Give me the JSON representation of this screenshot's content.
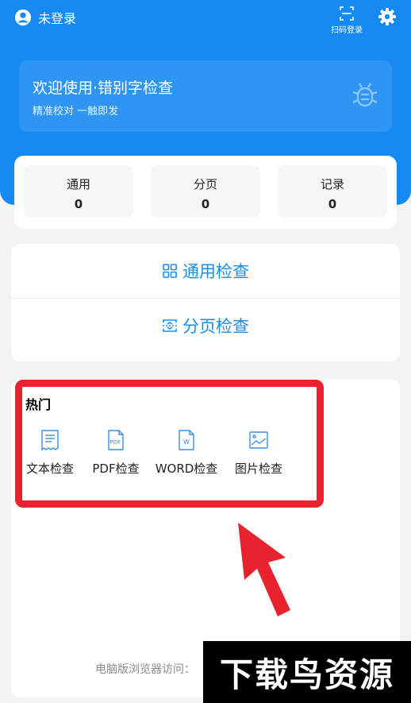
{
  "header": {
    "user_label": "未登录",
    "scan_label": "扫码登录",
    "welcome_title": "欢迎使用·错别字检查",
    "welcome_subtitle": "精准校对 一触即发"
  },
  "stats": [
    {
      "label": "通用",
      "value": "0"
    },
    {
      "label": "分页",
      "value": "0"
    },
    {
      "label": "记录",
      "value": "0"
    }
  ],
  "actions": {
    "general_label": "通用检查",
    "paged_label": "分页检查"
  },
  "hot": {
    "title": "热门",
    "items": [
      {
        "label": "文本检查",
        "icon": "text-doc-icon"
      },
      {
        "label": "PDF检查",
        "icon": "pdf-icon"
      },
      {
        "label": "WORD检查",
        "icon": "word-icon"
      },
      {
        "label": "图片检查",
        "icon": "image-icon"
      }
    ]
  },
  "footer": {
    "browser_access_text": "电脑版浏览器访问："
  },
  "watermark": {
    "text": "下载鸟资源"
  },
  "colors": {
    "brand_blue": "#1789f2",
    "action_blue": "#1a8ee6",
    "highlight_red": "#e8232d",
    "background": "#f2f3f5"
  }
}
